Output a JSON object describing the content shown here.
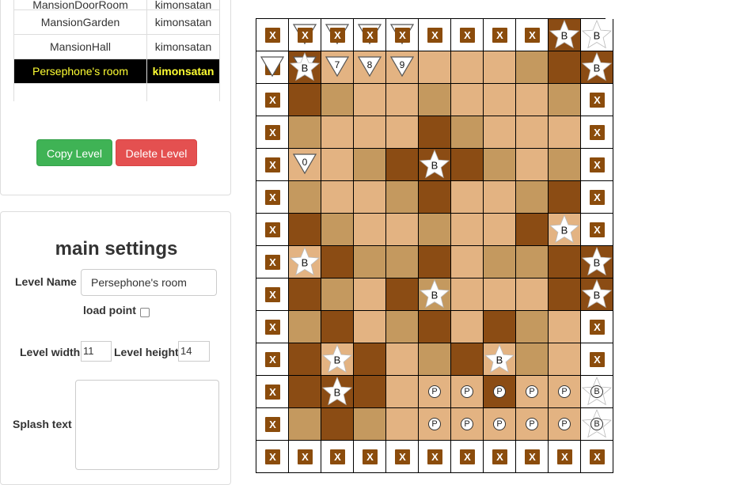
{
  "levels_table": {
    "rows": [
      {
        "name": "MansionDoorRoom",
        "owner": "kimonsatan",
        "selected": false
      },
      {
        "name": "MansionGarden",
        "owner": "kimonsatan",
        "selected": false
      },
      {
        "name": "MansionHall",
        "owner": "kimonsatan",
        "selected": false
      },
      {
        "name": "Persephone's room",
        "owner": "kimonsatan",
        "selected": true
      }
    ]
  },
  "buttons": {
    "copy": "Copy Level",
    "delete": "Delete Level"
  },
  "settings": {
    "title": "main settings",
    "level_name_label": "Level Name",
    "level_name_value": "Persephone's room",
    "load_point_label": "load point",
    "load_point_checked": false,
    "width_label": "Level width",
    "width_value": "11",
    "height_label": "Level height",
    "height_value": "14",
    "splash_label": "Splash text",
    "splash_value": ""
  },
  "colors": {
    "light": "#e3b382",
    "medium": "#c4995f",
    "dark": "#8b4c14",
    "white": "#ffffff",
    "icon_brown": "#8b4c0c"
  },
  "grid": {
    "width": 11,
    "height": 14,
    "rows": [
      "WWWWWWWWWDW",
      "WDLLLLLLMDD",
      "WDMLLMLLLMW",
      "WMLLLDMLLLW",
      "WLLMDDDMLMW",
      "WMLLMDLLMDW",
      "WDMLLMLLDLW",
      "WLDMMDLMMDD",
      "WDMLDMLLLDD",
      "WMDLMDLDMLW",
      "WDLDLMDLMLW",
      "WDDDLLLDLLW",
      "WMDMLLLLLLW",
      "WWWWWWWWWWW"
    ],
    "items": [
      {
        "r": 0,
        "c": 0,
        "k": "x"
      },
      {
        "r": 0,
        "c": 1,
        "k": "tri",
        "t": ""
      },
      {
        "r": 0,
        "c": 1,
        "k": "x"
      },
      {
        "r": 0,
        "c": 2,
        "k": "tri",
        "t": ""
      },
      {
        "r": 0,
        "c": 2,
        "k": "x"
      },
      {
        "r": 0,
        "c": 3,
        "k": "tri",
        "t": ""
      },
      {
        "r": 0,
        "c": 3,
        "k": "x"
      },
      {
        "r": 0,
        "c": 4,
        "k": "tri",
        "t": ""
      },
      {
        "r": 0,
        "c": 4,
        "k": "x"
      },
      {
        "r": 0,
        "c": 5,
        "k": "x"
      },
      {
        "r": 0,
        "c": 6,
        "k": "x"
      },
      {
        "r": 0,
        "c": 7,
        "k": "x"
      },
      {
        "r": 0,
        "c": 8,
        "k": "x"
      },
      {
        "r": 0,
        "c": 9,
        "k": "star",
        "t": "B"
      },
      {
        "r": 0,
        "c": 10,
        "k": "star",
        "t": "B"
      },
      {
        "r": 1,
        "c": 0,
        "k": "x"
      },
      {
        "r": 1,
        "c": 0,
        "k": "tri",
        "t": ""
      },
      {
        "r": 1,
        "c": 1,
        "k": "tri",
        "t": "6"
      },
      {
        "r": 1,
        "c": 1,
        "k": "star",
        "t": "B"
      },
      {
        "r": 1,
        "c": 2,
        "k": "tri",
        "t": "7"
      },
      {
        "r": 1,
        "c": 3,
        "k": "tri",
        "t": "8"
      },
      {
        "r": 1,
        "c": 4,
        "k": "tri",
        "t": "9"
      },
      {
        "r": 1,
        "c": 10,
        "k": "star",
        "t": "B"
      },
      {
        "r": 2,
        "c": 0,
        "k": "x"
      },
      {
        "r": 2,
        "c": 10,
        "k": "x"
      },
      {
        "r": 3,
        "c": 0,
        "k": "x"
      },
      {
        "r": 3,
        "c": 10,
        "k": "x"
      },
      {
        "r": 4,
        "c": 0,
        "k": "x"
      },
      {
        "r": 4,
        "c": 1,
        "k": "tri",
        "t": "0"
      },
      {
        "r": 4,
        "c": 5,
        "k": "star",
        "t": "B"
      },
      {
        "r": 4,
        "c": 10,
        "k": "x"
      },
      {
        "r": 5,
        "c": 0,
        "k": "x"
      },
      {
        "r": 5,
        "c": 10,
        "k": "x"
      },
      {
        "r": 6,
        "c": 0,
        "k": "x"
      },
      {
        "r": 6,
        "c": 9,
        "k": "star",
        "t": "B"
      },
      {
        "r": 6,
        "c": 10,
        "k": "x"
      },
      {
        "r": 7,
        "c": 0,
        "k": "x"
      },
      {
        "r": 7,
        "c": 1,
        "k": "star",
        "t": "B"
      },
      {
        "r": 7,
        "c": 10,
        "k": "star",
        "t": "B"
      },
      {
        "r": 8,
        "c": 0,
        "k": "x"
      },
      {
        "r": 8,
        "c": 5,
        "k": "star",
        "t": "B"
      },
      {
        "r": 8,
        "c": 10,
        "k": "star",
        "t": "B"
      },
      {
        "r": 9,
        "c": 0,
        "k": "x"
      },
      {
        "r": 9,
        "c": 10,
        "k": "x"
      },
      {
        "r": 10,
        "c": 0,
        "k": "x"
      },
      {
        "r": 10,
        "c": 2,
        "k": "star",
        "t": "B"
      },
      {
        "r": 10,
        "c": 7,
        "k": "star",
        "t": "B"
      },
      {
        "r": 10,
        "c": 10,
        "k": "x"
      },
      {
        "r": 11,
        "c": 0,
        "k": "x"
      },
      {
        "r": 11,
        "c": 2,
        "k": "star",
        "t": "B"
      },
      {
        "r": 11,
        "c": 5,
        "k": "p",
        "t": "P"
      },
      {
        "r": 11,
        "c": 6,
        "k": "p",
        "t": "P"
      },
      {
        "r": 11,
        "c": 7,
        "k": "p",
        "t": "P"
      },
      {
        "r": 11,
        "c": 8,
        "k": "p",
        "t": "P"
      },
      {
        "r": 11,
        "c": 9,
        "k": "p",
        "t": "P"
      },
      {
        "r": 11,
        "c": 10,
        "k": "star",
        "t": "B"
      },
      {
        "r": 11,
        "c": 10,
        "k": "p",
        "t": "B"
      },
      {
        "r": 12,
        "c": 0,
        "k": "x"
      },
      {
        "r": 12,
        "c": 5,
        "k": "p",
        "t": "P"
      },
      {
        "r": 12,
        "c": 6,
        "k": "p",
        "t": "P"
      },
      {
        "r": 12,
        "c": 7,
        "k": "p",
        "t": "P"
      },
      {
        "r": 12,
        "c": 8,
        "k": "p",
        "t": "P"
      },
      {
        "r": 12,
        "c": 9,
        "k": "p",
        "t": "P"
      },
      {
        "r": 12,
        "c": 10,
        "k": "star",
        "t": "B"
      },
      {
        "r": 12,
        "c": 10,
        "k": "p",
        "t": "B"
      },
      {
        "r": 13,
        "c": 0,
        "k": "x"
      },
      {
        "r": 13,
        "c": 1,
        "k": "x"
      },
      {
        "r": 13,
        "c": 2,
        "k": "x"
      },
      {
        "r": 13,
        "c": 3,
        "k": "x"
      },
      {
        "r": 13,
        "c": 4,
        "k": "x"
      },
      {
        "r": 13,
        "c": 5,
        "k": "x"
      },
      {
        "r": 13,
        "c": 6,
        "k": "x"
      },
      {
        "r": 13,
        "c": 7,
        "k": "x"
      },
      {
        "r": 13,
        "c": 8,
        "k": "x"
      },
      {
        "r": 13,
        "c": 9,
        "k": "x"
      },
      {
        "r": 13,
        "c": 10,
        "k": "x"
      }
    ],
    "x_label": "X"
  }
}
